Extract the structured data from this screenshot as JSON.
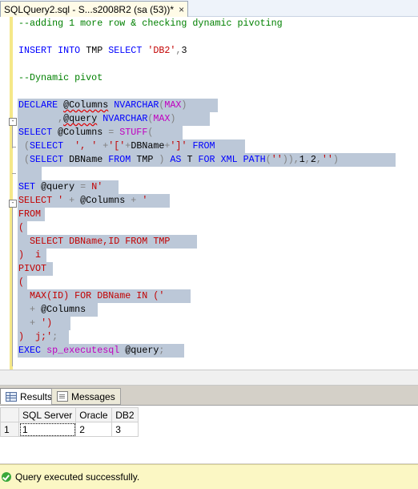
{
  "document_tab": {
    "title": "SQLQuery2.sql - S...s2008R2 (sa (53))*",
    "close_glyph": "×"
  },
  "editor": {
    "lines": [
      "--adding 1 more row & checking dynamic pivoting",
      "",
      "INSERT INTO TMP SELECT 'DB2',3",
      "",
      "--Dynamic pivot",
      "",
      "DECLARE @Columns NVARCHAR(MAX)",
      "       ,@query NVARCHAR(MAX)",
      "SELECT @Columns = STUFF(",
      " (SELECT  ', ' +'['+DBName+']' FROM",
      " (SELECT DBName FROM TMP ) AS T FOR XML PATH('')),1,2,'')",
      "",
      "SET @query = N'",
      "SELECT ' + @Columns + '",
      "FROM",
      "(",
      "  SELECT DBName,ID FROM TMP",
      ")  i",
      "PIVOT",
      "(",
      "  MAX(ID) FOR DBName IN ('",
      "  + @Columns",
      "  + ')",
      ")  j;';",
      "EXEC sp_executesql @query;"
    ]
  },
  "results_tabs": {
    "results_label": "Results",
    "messages_label": "Messages"
  },
  "results_grid": {
    "columns": [
      "SQL Server",
      "Oracle",
      "DB2"
    ],
    "rows": [
      {
        "row_number": "1",
        "values": [
          "1",
          "2",
          "3"
        ]
      }
    ]
  },
  "status": {
    "message": "Query executed successfully."
  },
  "colors": {
    "keyword": "#0000ff",
    "comment": "#008000",
    "string": "#c20000",
    "function": "#c000c0",
    "selection": "#bcc8d8",
    "status_bg": "#fbf7c4"
  }
}
